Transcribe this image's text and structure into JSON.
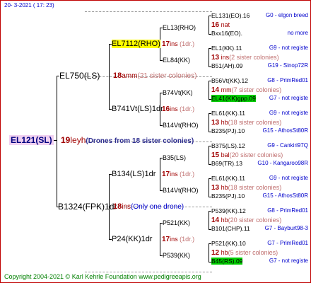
{
  "header": {
    "date": "20-  3-2021 ( 17: 23)"
  },
  "footer": {
    "copyright": "Copyright 2004-2021 © Karl Kehrle Foundation   www.pedigreeapis.org"
  },
  "root": {
    "name": "EL121(SL)",
    "year": "19",
    "breeder": "leyh",
    "note": "(Drones from 18 sister colonies)"
  },
  "g1": [
    {
      "name": "EL750(LS)",
      "year": "18",
      "breeder": "amm",
      "note": "(21 sister colonies)"
    },
    {
      "name": "B1324(FPK)1dr",
      "year": "18",
      "breeder": "ins",
      "note": "(Only one drone)"
    }
  ],
  "g2": [
    {
      "name": "EL7112(RHO)",
      "year": "17",
      "breeder": "ins",
      "note": "(1dr.)"
    },
    {
      "name": "B741Vt(LS)1dr",
      "year": "16",
      "breeder": "ins",
      "note": "(1dr.)"
    },
    {
      "name": "B134(LS)1dr",
      "year": "17",
      "breeder": "ins",
      "note": "(1dr.)"
    },
    {
      "name": "P24(KK)1dr",
      "year": "17",
      "breeder": "ins",
      "note": "(1dr.)"
    }
  ],
  "g3": [
    {
      "name": "EL13(RHO)"
    },
    {
      "name": "EL84(KK)"
    },
    {
      "name": "B74Vt(KK)"
    },
    {
      "name": "B14Vt(RHO)"
    },
    {
      "name": "B35(LS)"
    },
    {
      "name": "B14Vt(RHO)"
    },
    {
      "name": "P521(KK)"
    },
    {
      "name": "P539(KK)"
    }
  ],
  "g4": [
    {
      "top": "EL131(EO).16",
      "top_r": "G0 - elgon breed",
      "mid_y": "16",
      "mid_b": "nat",
      "bot": "Bxx16(EO).",
      "bot_r": "no more"
    },
    {
      "top": "EL1(KK).11",
      "top_r": "G9 - not registe",
      "mid_y": "13",
      "mid_b": "ins",
      "mid_n": "(2 sister colonies)",
      "bot": "B51(AH).09",
      "bot_r": "G19 - Sinop72R"
    },
    {
      "top": "B56Vt(KK).12",
      "top_r": "G8 - PrimRed01",
      "mid_y": "14",
      "mid_b": "mm",
      "mid_n": "(7 sister colonies)",
      "bot": "EL41(KK)gpp.09",
      "bot_r": "G7 - not registe"
    },
    {
      "top": "EL61(KK).11",
      "top_r": "G9 - not registe",
      "mid_y": "13",
      "mid_b": "hb",
      "mid_n": "(18 sister colonies)",
      "bot": "B235(PJ).10",
      "bot_r": "G15 - AthosSt80R"
    },
    {
      "top": "B375(LS).12",
      "top_r": "G9 - Cankiri97Q",
      "mid_y": "15",
      "mid_b": "bal",
      "mid_n": "(20 sister colonies)",
      "bot": "B69(TR).13",
      "bot_r": "G10 - Kangaroo98R"
    },
    {
      "top": "EL61(KK).11",
      "top_r": "G9 - not registe",
      "mid_y": "13",
      "mid_b": "hb",
      "mid_n": "(18 sister colonies)",
      "bot": "B235(PJ).10",
      "bot_r": "G15 - AthosSt80R"
    },
    {
      "top": "P539(KK).12",
      "top_r": "G8 - PrimRed01",
      "mid_y": "14",
      "mid_b": "hb",
      "mid_n": "(20 sister colonies)",
      "bot": "B101(CHP).11",
      "bot_r": "G7 - Bayburt98-3"
    },
    {
      "top": "P521(KK).10",
      "top_r": "G7 - PrimRed01",
      "mid_y": "12",
      "mid_b": "hb",
      "mid_n": "(5 sister colonies)",
      "bot": "B45(RS).09",
      "bot_r": "G7 - not registe"
    }
  ]
}
